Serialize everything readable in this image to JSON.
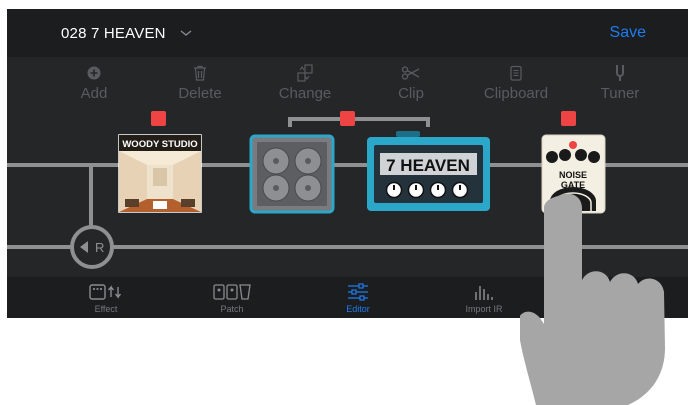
{
  "header": {
    "preset_name": "028 7 HEAVEN",
    "save_label": "Save"
  },
  "toolbar": {
    "items": [
      {
        "label": "Add",
        "icon": "plus-circle-icon"
      },
      {
        "label": "Delete",
        "icon": "trash-icon"
      },
      {
        "label": "Change",
        "icon": "swap-icon"
      },
      {
        "label": "Clip",
        "icon": "scissors-icon"
      },
      {
        "label": "Clipboard",
        "icon": "clipboard-icon"
      },
      {
        "label": "Tuner",
        "icon": "tuning-fork-icon"
      }
    ]
  },
  "chain": {
    "cab_label": "WOODY STUDIO",
    "amp_label": "7 HEAVEN",
    "pedal_label_line1": "NOISE",
    "pedal_label_line2": "GATE",
    "return_label": "R"
  },
  "bottom_nav": {
    "items": [
      {
        "label": "Effect",
        "active": false
      },
      {
        "label": "Patch",
        "active": false
      },
      {
        "label": "Editor",
        "active": true
      },
      {
        "label": "Import IR",
        "active": false
      }
    ]
  },
  "colors": {
    "accent": "#1e7cf2",
    "marker": "#ef4444",
    "amp": "#2aa7c9",
    "panel": "#252628"
  }
}
